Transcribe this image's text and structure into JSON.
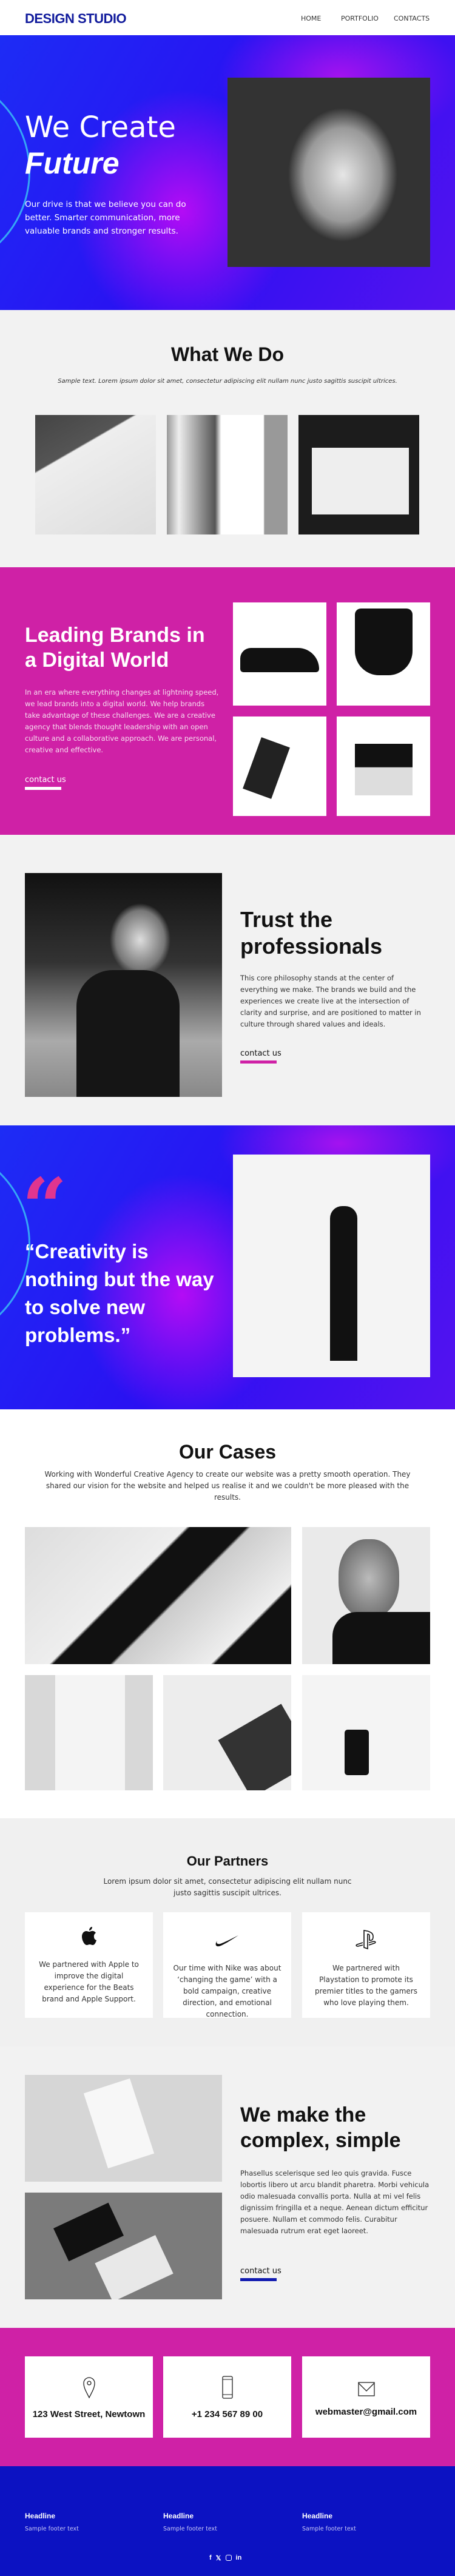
{
  "header": {
    "logo": "DESIGN STUDIO",
    "nav": [
      "HOME",
      "PORTFOLIO",
      "CONTACTS"
    ]
  },
  "hero": {
    "line1": "We Create",
    "line2": "Future",
    "text": "Our drive is that we believe you can do better. Smarter communication, more valuable brands and stronger results."
  },
  "what_we_do": {
    "title": "What We Do",
    "subtitle": "Sample text. Lorem ipsum dolor sit amet, consectetur adipiscing elit nullam nunc justo sagittis suscipit ultrices."
  },
  "brands": {
    "title": "Leading Brands in a Digital World",
    "text": "In an era where everything changes at lightning speed, we lead brands into a digital world. We help brands take advantage of these challenges. We are a creative agency that blends thought leadership with an open culture and a collaborative approach. We are personal, creative and effective.",
    "link": "contact us"
  },
  "trust": {
    "title": "Trust the professionals",
    "text": "This core philosophy stands at the center of everything we make. The brands we build and the experiences we create live at the intersection of clarity and surprise, and are positioned to matter in culture through shared values and ideals.",
    "link": "contact us"
  },
  "quote": {
    "mark": "“",
    "text": "“Creativity is nothing but the way to solve new problems.”"
  },
  "cases": {
    "title": "Our Cases",
    "text": "Working with Wonderful Creative Agency to create our website was a pretty smooth operation. They shared our vision for the website and helped us realise it and we couldn't be more pleased with the results."
  },
  "partners": {
    "title": "Our Partners",
    "text": "Lorem ipsum dolor sit amet, consectetur adipiscing elit nullam nunc justo sagittis suscipit ultrices.",
    "items": [
      {
        "icon": "apple-icon",
        "text": "We partnered with Apple to improve the digital experience for the Beats brand and Apple Support."
      },
      {
        "icon": "nike-icon",
        "text": "Our time with Nike was about ‘changing the game’ with a bold campaign, creative direction, and emotional connection."
      },
      {
        "icon": "playstation-icon",
        "text": "We partnered with Playstation to promote its premier titles to the gamers who love playing them."
      }
    ]
  },
  "complex": {
    "title": "We make the complex, simple",
    "text": "Phasellus scelerisque sed leo quis gravida. Fusce lobortis libero ut arcu blandit pharetra. Morbi vehicula odio malesuada convallis porta. Nulla at mi vel felis dignissim fringilla et a neque. Aenean dictum efficitur posuere. Nullam et commodo felis. Curabitur malesuada rutrum erat eget laoreet.",
    "link": "contact us"
  },
  "contacts": [
    {
      "icon": "location-pin-icon",
      "text": "123 West Street, Newtown"
    },
    {
      "icon": "phone-icon",
      "text": "+1 234 567 89 00"
    },
    {
      "icon": "envelope-icon",
      "text": "webmaster@gmail.com"
    }
  ],
  "footer": {
    "columns": [
      {
        "headline": "Headline",
        "text": "Sample footer text"
      },
      {
        "headline": "Headline",
        "text": "Sample footer text"
      },
      {
        "headline": "Headline",
        "text": "Sample footer text"
      }
    ],
    "social": [
      "facebook-icon",
      "twitter-icon",
      "instagram-icon",
      "linkedin-icon"
    ]
  },
  "colors": {
    "brand_blue": "#0c12c2",
    "magenta": "#cf21a6",
    "logo": "#111b9c"
  }
}
